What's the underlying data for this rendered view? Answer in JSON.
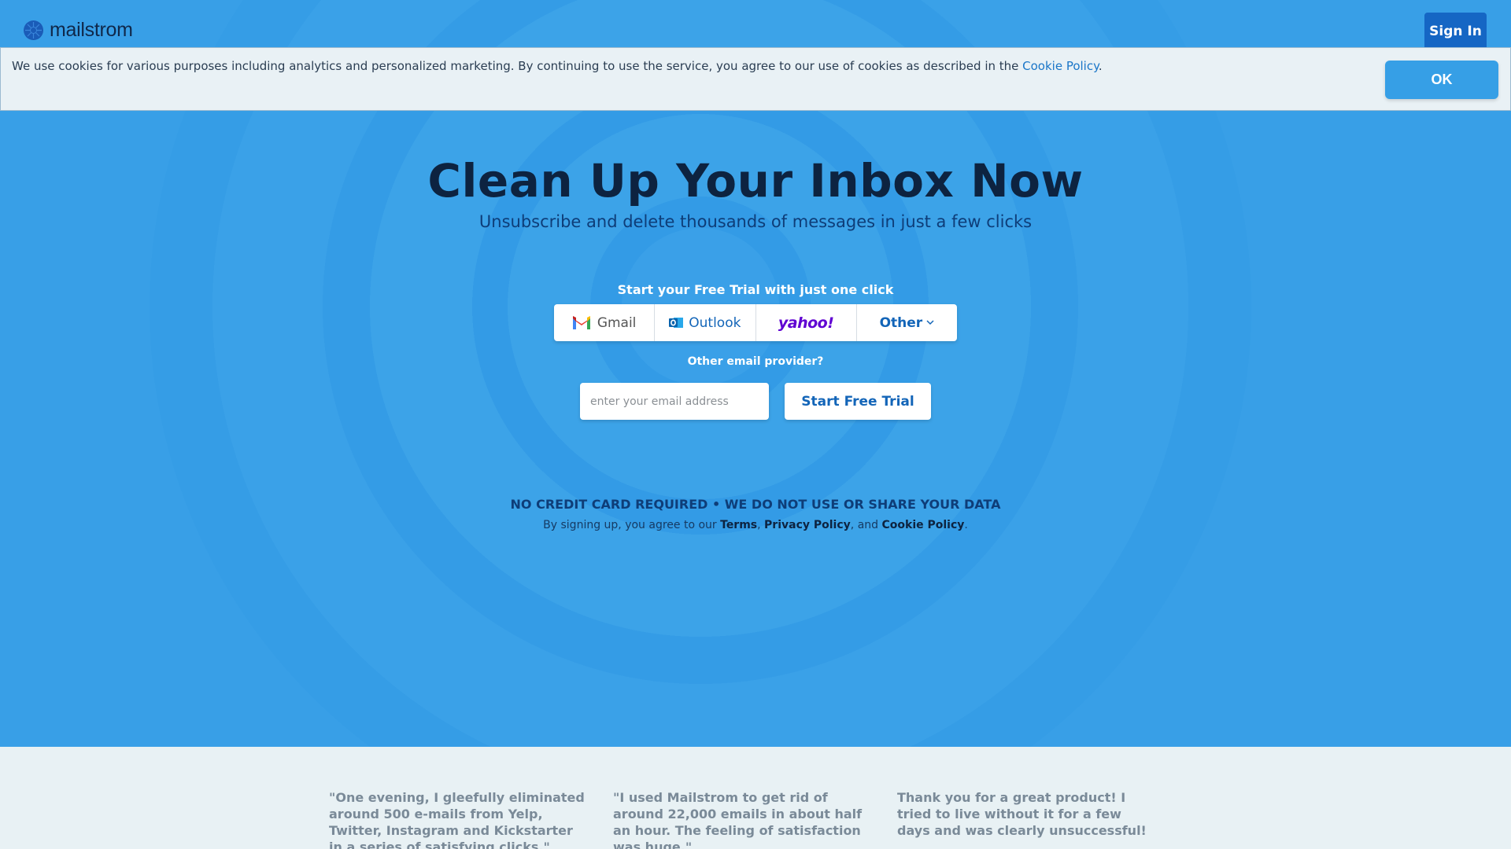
{
  "header": {
    "logo_text": "mailstrom",
    "sign_in_label": "Sign In"
  },
  "cookie_banner": {
    "text": "We use cookies for various purposes including analytics and personalized marketing. By continuing to use the service, you agree to our use of cookies as described in the ",
    "link_label": "Cookie Policy",
    "text_end": ".",
    "ok_label": "OK"
  },
  "hero": {
    "title": "Clean Up Your Inbox Now",
    "subtitle": "Unsubscribe and delete thousands of messages in just a few clicks",
    "trial_label": "Start your Free Trial with just one click",
    "providers": [
      {
        "label": "Gmail",
        "icon": "gmail-icon"
      },
      {
        "label": "Outlook",
        "icon": "outlook-icon"
      },
      {
        "label": "yahoo!",
        "icon": "yahoo-logo"
      },
      {
        "label": "Other",
        "icon": "chevron-down-icon"
      }
    ],
    "other_provider_label": "Other email provider?",
    "email_placeholder": "enter your email address",
    "start_button_label": "Start Free Trial",
    "no_credit_text": "NO CREDIT CARD REQUIRED • WE DO NOT USE OR SHARE YOUR DATA",
    "terms": {
      "prefix": "By signing up, you agree to our ",
      "terms_label": "Terms",
      "sep1": ", ",
      "privacy_label": "Privacy Policy",
      "sep2": ", and ",
      "cookie_label": "Cookie Policy",
      "suffix": "."
    }
  },
  "testimonials": [
    {
      "text": "\"One evening, I gleefully eliminated around 500 e-mails from Yelp, Twitter, Instagram and Kickstarter in a series of satisfying clicks.\""
    },
    {
      "text": "\"I used Mailstrom to get rid of around 22,000 emails in about half an hour. The feeling of satisfaction was huge.\""
    },
    {
      "text": "Thank you for a great product! I tried to live without it for a few days and was clearly unsuccessful!"
    }
  ],
  "colors": {
    "hero_blue": "#389fe7",
    "accent_blue": "#1566c4",
    "title_navy": "#0d2340",
    "link_blue": "#1a76c8"
  }
}
